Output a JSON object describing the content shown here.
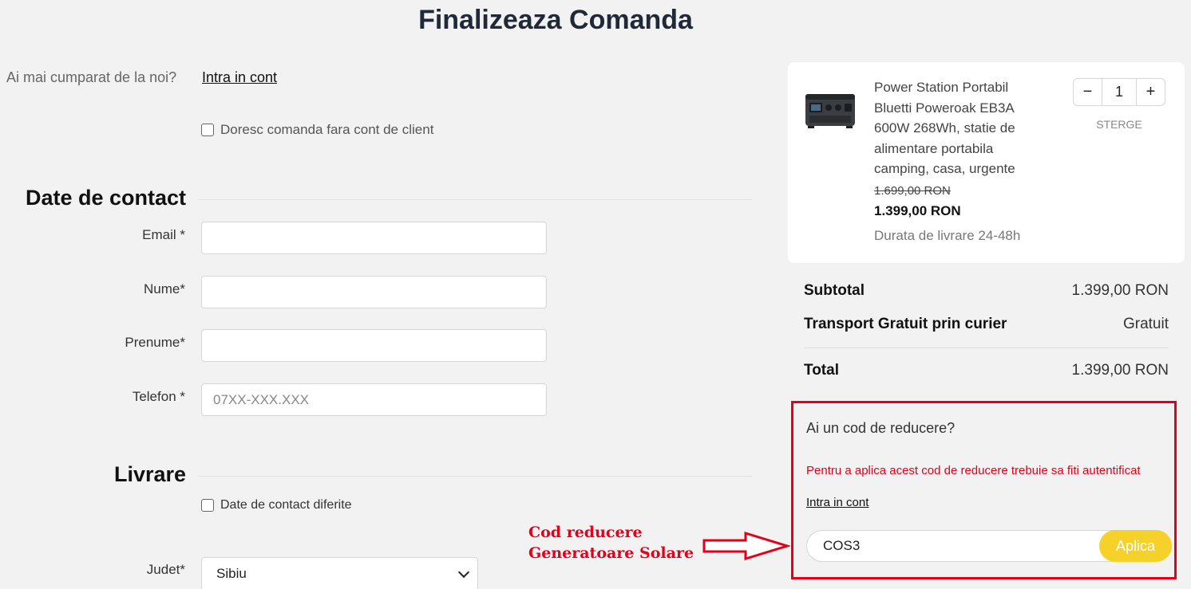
{
  "page": {
    "title": "Finalizeaza Comanda"
  },
  "account": {
    "question": "Ai mai cumparat de la noi?",
    "login_link": "Intra in cont",
    "guest_checkbox": "Doresc comanda fara cont de client"
  },
  "contact": {
    "title": "Date de contact",
    "email_label": "Email *",
    "name_label": "Nume*",
    "surname_label": "Prenume*",
    "phone_label": "Telefon *",
    "phone_placeholder": "07XX-XXX.XXX"
  },
  "delivery": {
    "title": "Livrare",
    "different_contact_checkbox": "Date de contact diferite",
    "county_label": "Judet*",
    "county_value": "Sibiu"
  },
  "annotation": {
    "line1": "Cod reducere",
    "line2": "Generatoare Solare",
    "color": "#e3001b"
  },
  "cart": {
    "product_name": "Power Station Portabil Bluetti Poweroak EB3A 600W 268Wh, statie de alimentare portabila camping, casa, urgente",
    "old_price": "1.699,00 RON",
    "price": "1.399,00 RON",
    "delivery_time": "Durata de livrare 24-48h",
    "quantity": "1",
    "minus": "−",
    "plus": "+",
    "remove_label": "STERGE"
  },
  "summary": {
    "subtotal_label": "Subtotal",
    "subtotal_value": "1.399,00 RON",
    "shipping_label": "Transport Gratuit prin curier",
    "shipping_value": "Gratuit",
    "total_label": "Total",
    "total_value": "1.399,00 RON"
  },
  "discount": {
    "title": "Ai un cod de reducere?",
    "warning": "Pentru a aplica acest cod de reducere trebuie sa fiti autentificat",
    "login_link": "Intra in cont",
    "code_value": "COS3",
    "apply_label": "Aplica",
    "accent": "#f6d12a"
  }
}
